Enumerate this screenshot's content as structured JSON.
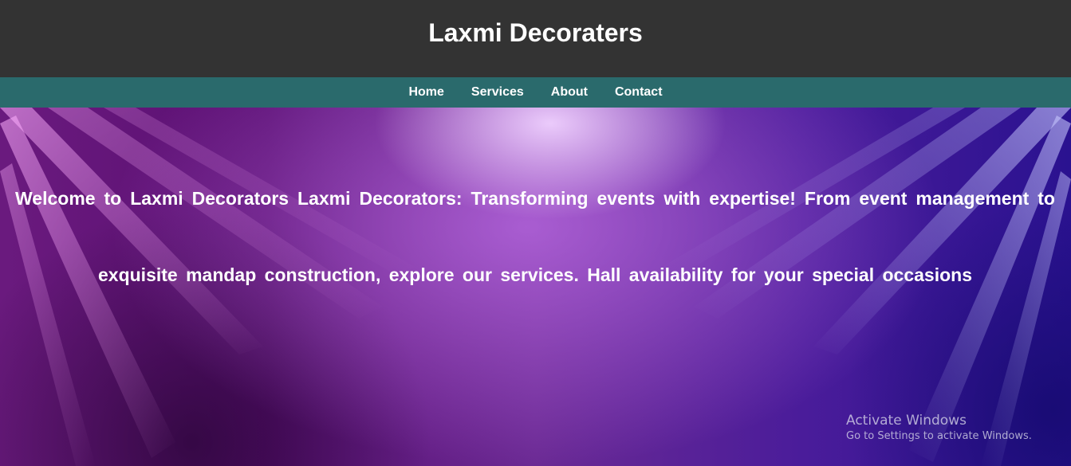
{
  "header": {
    "title": "Laxmi Decoraters"
  },
  "nav": {
    "items": [
      {
        "label": "Home"
      },
      {
        "label": "Services"
      },
      {
        "label": "About"
      },
      {
        "label": "Contact"
      }
    ]
  },
  "hero": {
    "text": "Welcome to Laxmi Decorators Laxmi Decorators: Transforming events with expertise! From event management to exquisite mandap construction, explore our services. Hall availability for your special occasions"
  },
  "watermark": {
    "title": "Activate Windows",
    "subtitle": "Go to Settings to activate Windows."
  },
  "colors": {
    "header_bg": "#333333",
    "nav_bg": "#2a6a6c",
    "text": "#ffffff"
  }
}
